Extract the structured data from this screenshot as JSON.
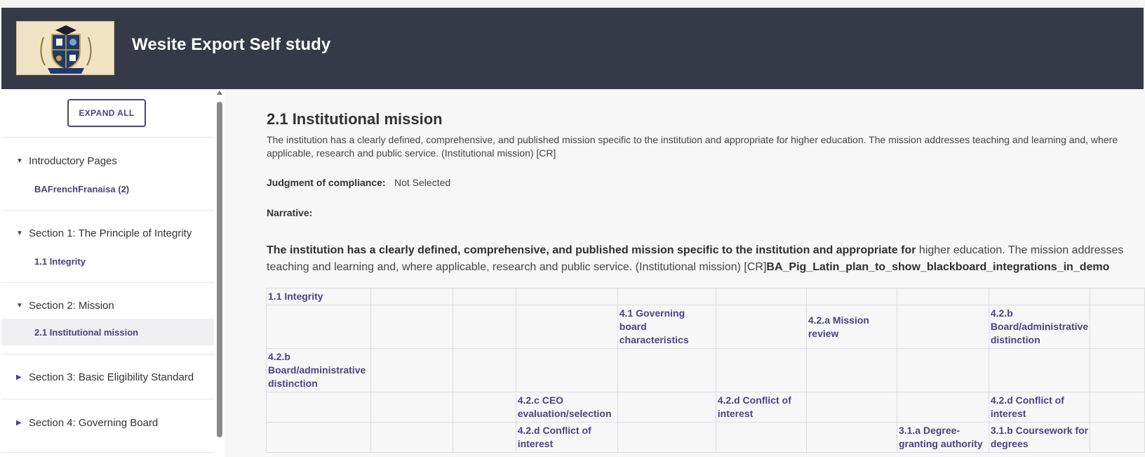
{
  "header": {
    "title": "Wesite Export Self study"
  },
  "sidebar": {
    "expand_all_label": "EXPAND ALL",
    "sections": [
      {
        "label": "Introductory Pages",
        "expanded": true,
        "children": [
          "BAFrenchFranaisa (2)"
        ]
      },
      {
        "label": "Section 1: The Principle of Integrity",
        "expanded": true,
        "children": [
          "1.1 Integrity"
        ]
      },
      {
        "label": "Section 2: Mission",
        "expanded": true,
        "children": [
          "2.1 Institutional mission"
        ]
      },
      {
        "label": "Section 3: Basic Eligibility Standard",
        "expanded": false,
        "children": []
      },
      {
        "label": "Section 4: Governing Board",
        "expanded": false,
        "children": []
      }
    ],
    "active_child": "2.1 Institutional mission"
  },
  "main": {
    "title": "2.1 Institutional mission",
    "description": "The institution has a clearly defined, comprehensive, and published mission specific to the institution and appropriate for higher education. The mission addresses teaching and learning and, where applicable, research and public service. (Institutional mission) [CR]",
    "judgment_label": "Judgment of compliance:",
    "judgment_value": "Not Selected",
    "narrative_label": "Narrative:",
    "narrative_bold": "The institution has a clearly defined, comprehensive, and published mission specific to the institution and appropriate for",
    "narrative_plain": " higher education. The mission addresses teaching and learning and, where applicable, research and public service. (Institutional mission) [CR]",
    "narrative_link": "BA_Pig_Latin_plan_to_show_blackboard_integrations_in_demo",
    "table": [
      [
        "1.1 Integrity",
        "",
        "",
        "",
        "",
        "",
        "",
        "",
        "",
        ""
      ],
      [
        "",
        "",
        "",
        "",
        "4.1 Governing board characteristics",
        "",
        "4.2.a Mission review",
        "",
        "4.2.b Board/administrative distinction",
        ""
      ],
      [
        "4.2.b Board/administrative distinction",
        "",
        "",
        "",
        "",
        "",
        "",
        "",
        "",
        ""
      ],
      [
        "",
        "",
        "",
        "4.2.c CEO evaluation/selection",
        "",
        "4.2.d Conflict of interest",
        "",
        "",
        "4.2.d Conflict of interest",
        ""
      ],
      [
        "",
        "",
        "",
        "4.2.d Conflict of interest",
        "",
        "",
        "",
        "3.1.a Degree-granting authority",
        "3.1.b Coursework for degrees",
        ""
      ]
    ]
  }
}
